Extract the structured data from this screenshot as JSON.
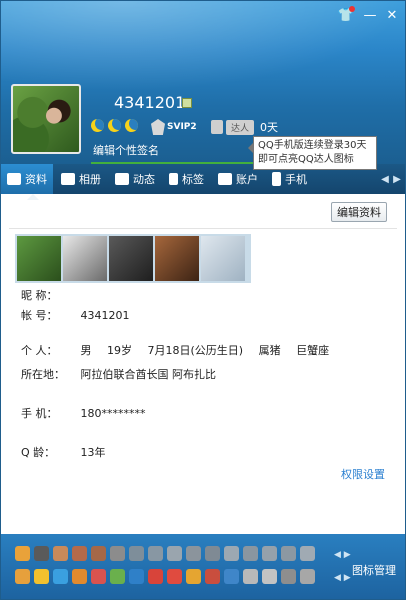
{
  "window": {
    "controls": [
      "skin-icon",
      "minimize-icon",
      "close-icon"
    ]
  },
  "profile": {
    "qq_number": "4341201",
    "signature": "编辑个性签名",
    "svip_label": "SVIP2",
    "daren_tag": "达人",
    "daren_days": "0天"
  },
  "tooltip": {
    "line1": "QQ手机版连续登录30天",
    "line2": "即可点亮QQ达人图标"
  },
  "tabs": [
    {
      "label": "资料",
      "icon": "profile-card-icon",
      "active": true
    },
    {
      "label": "相册",
      "icon": "album-icon"
    },
    {
      "label": "动态",
      "icon": "feed-icon"
    },
    {
      "label": "标签",
      "icon": "tag-icon"
    },
    {
      "label": "账户",
      "icon": "wallet-icon"
    },
    {
      "label": "手机",
      "icon": "phone-icon"
    }
  ],
  "content": {
    "edit_button": "编辑资料",
    "fields": {
      "nickname_label": "昵 称：",
      "nickname_value": "",
      "account_label": "帐 号：",
      "account_value": "4341201",
      "person_label": "个 人：",
      "gender": "男",
      "age": "19岁",
      "birthday": "7月18日(公历生日)",
      "zodiac": "属猪",
      "constellation": "巨蟹座",
      "location_label": "所在地：",
      "location_value": "阿拉伯联合酋长国 阿布扎比",
      "phone_label": "手 机：",
      "phone_value": "180********",
      "qage_label": "Q 龄：",
      "qage_value": "13年"
    },
    "permission_link": "权限设置"
  },
  "iconbar": {
    "manage_label": "图标管理"
  },
  "colors": {
    "header": "#2b86c9",
    "tabbar": "#1b5886",
    "active_tab": "#2c8ed2",
    "link": "#2a7fd0",
    "iconbar": "#2a7fc0"
  }
}
